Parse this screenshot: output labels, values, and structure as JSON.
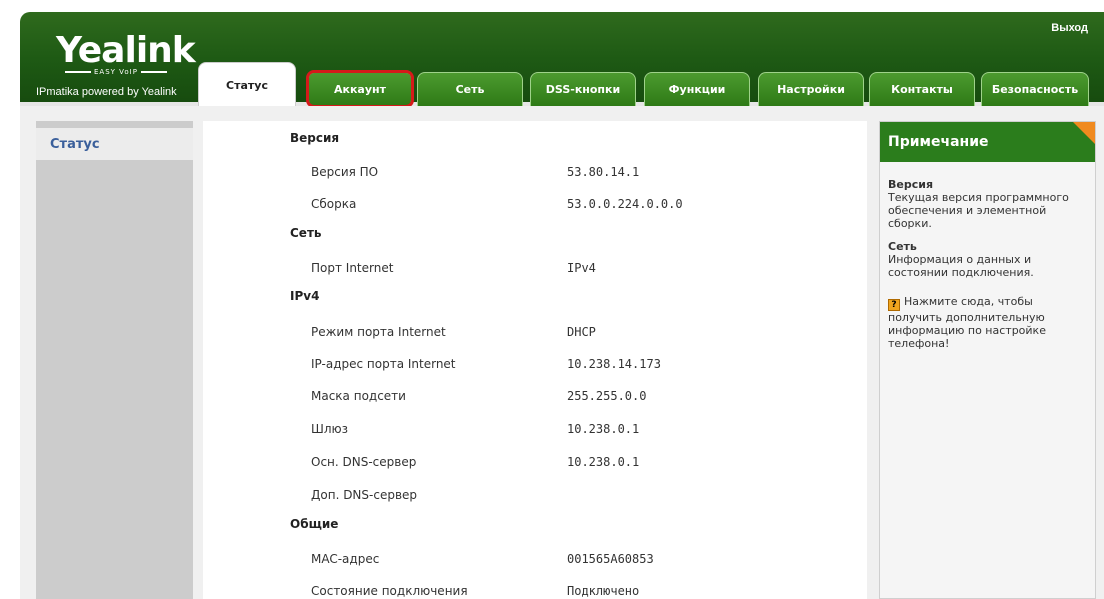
{
  "header": {
    "logo_text": "Yealink",
    "logo_sub": "EASY VoIP",
    "powered": "IPmatika powered by Yealink",
    "exit_label": "Выход"
  },
  "tabs": [
    {
      "label": "Статус",
      "active": true
    },
    {
      "label": "Аккаунт",
      "highlighted": true
    },
    {
      "label": "Сеть"
    },
    {
      "label": "DSS-кнопки"
    },
    {
      "label": "Функции"
    },
    {
      "label": "Настройки"
    },
    {
      "label": "Контакты"
    },
    {
      "label": "Безопасность"
    }
  ],
  "sidebar": {
    "items": [
      {
        "label": "Статус"
      }
    ]
  },
  "status": {
    "version": {
      "title": "Версия",
      "fw_label": "Версия ПО",
      "fw_value": "53.80.14.1",
      "build_label": "Сборка",
      "build_value": "53.0.0.224.0.0.0"
    },
    "network": {
      "title": "Сеть",
      "port_label": "Порт Internet",
      "port_value": "IPv4"
    },
    "ipv4": {
      "title": "IPv4",
      "mode_label": "Режим порта Internet",
      "mode_value": "DHCP",
      "ip_label": "IP-адрес порта Internet",
      "ip_value": "10.238.14.173",
      "mask_label": "Маска подсети",
      "mask_value": "255.255.0.0",
      "gw_label": "Шлюз",
      "gw_value": "10.238.0.1",
      "dns1_label": "Осн. DNS-сервер",
      "dns1_value": "10.238.0.1",
      "dns2_label": "Доп. DNS-сервер",
      "dns2_value": ""
    },
    "general": {
      "title": "Общие",
      "mac_label": "MAC-адрес",
      "mac_value": "001565A60853",
      "conn_label": "Состояние подключения",
      "conn_value": "Подключено"
    }
  },
  "note": {
    "title": "Примечание",
    "version_head": "Версия",
    "version_text": "Текущая версия программного обеспечения и элементной сборки.",
    "network_head": "Сеть",
    "network_text": "Информация о данных и состоянии подключения.",
    "help_text": "Нажмите сюда, чтобы получить дополнительную информацию по настройке телефона!"
  },
  "colors": {
    "brand_green": "#2b7d1c",
    "highlight_red": "#d51a1a",
    "accent_orange": "#f08a1f"
  }
}
